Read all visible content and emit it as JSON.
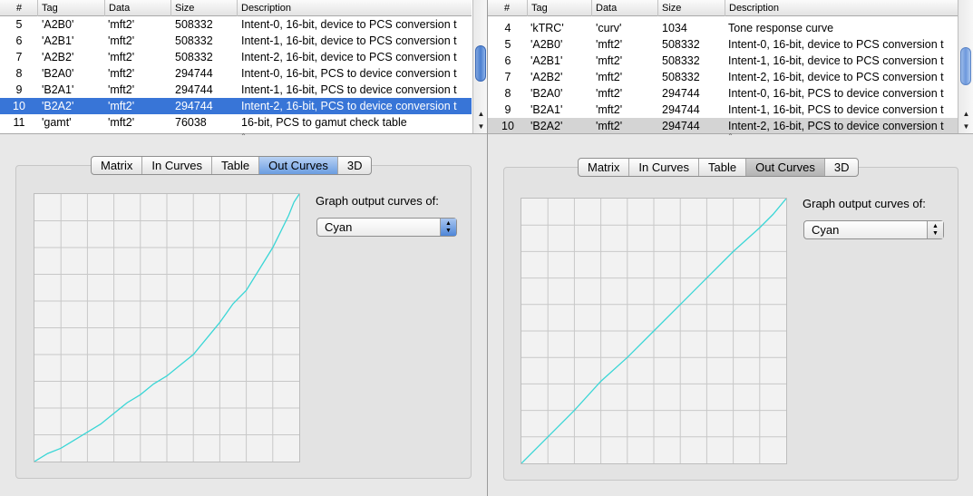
{
  "left": {
    "columns": [
      "#",
      "Tag",
      "Data",
      "Size",
      "Description"
    ],
    "rows": [
      {
        "n": "5",
        "tag": "'A2B0'",
        "data": "'mft2'",
        "size": "508332",
        "desc": "Intent-0, 16-bit, device to PCS conversion t"
      },
      {
        "n": "6",
        "tag": "'A2B1'",
        "data": "'mft2'",
        "size": "508332",
        "desc": "Intent-1, 16-bit, device to PCS conversion t"
      },
      {
        "n": "7",
        "tag": "'A2B2'",
        "data": "'mft2'",
        "size": "508332",
        "desc": "Intent-2, 16-bit, device to PCS conversion t"
      },
      {
        "n": "8",
        "tag": "'B2A0'",
        "data": "'mft2'",
        "size": "294744",
        "desc": "Intent-0, 16-bit, PCS to device conversion t"
      },
      {
        "n": "9",
        "tag": "'B2A1'",
        "data": "'mft2'",
        "size": "294744",
        "desc": "Intent-1, 16-bit, PCS to device conversion t"
      },
      {
        "n": "10",
        "tag": "'B2A2'",
        "data": "'mft2'",
        "size": "294744",
        "desc": "Intent-2, 16-bit, PCS to device conversion t"
      },
      {
        "n": "11",
        "tag": "'gamt'",
        "data": "'mft2'",
        "size": "76038",
        "desc": "16-bit, PCS to gamut check table"
      }
    ],
    "selected_row": 5,
    "tabs": [
      "Matrix",
      "In Curves",
      "Table",
      "Out Curves",
      "3D"
    ],
    "active_tab": 3,
    "graph_label": "Graph output curves of:",
    "channel": "Cyan",
    "curve_color": "#3ad6d6",
    "chart_data": {
      "type": "line",
      "x": [
        0,
        0.05,
        0.1,
        0.15,
        0.2,
        0.25,
        0.3,
        0.35,
        0.4,
        0.45,
        0.5,
        0.55,
        0.6,
        0.65,
        0.7,
        0.75,
        0.8,
        0.85,
        0.9,
        0.93,
        0.96,
        0.98,
        1.0
      ],
      "series": [
        {
          "values": [
            0,
            0.03,
            0.05,
            0.08,
            0.11,
            0.14,
            0.18,
            0.22,
            0.25,
            0.29,
            0.32,
            0.36,
            0.4,
            0.46,
            0.52,
            0.59,
            0.64,
            0.72,
            0.8,
            0.86,
            0.92,
            0.97,
            1.0
          ]
        }
      ],
      "xlim": [
        0,
        1
      ],
      "ylim": [
        0,
        1
      ],
      "grid": true
    }
  },
  "right": {
    "columns": [
      "#",
      "Tag",
      "Data",
      "Size",
      "Description"
    ],
    "rows": [
      {
        "n": "4",
        "tag": "'kTRC'",
        "data": "'curv'",
        "size": "1034",
        "desc": "Tone response curve"
      },
      {
        "n": "5",
        "tag": "'A2B0'",
        "data": "'mft2'",
        "size": "508332",
        "desc": "Intent-0, 16-bit, device to PCS conversion t"
      },
      {
        "n": "6",
        "tag": "'A2B1'",
        "data": "'mft2'",
        "size": "508332",
        "desc": "Intent-1, 16-bit, device to PCS conversion t"
      },
      {
        "n": "7",
        "tag": "'A2B2'",
        "data": "'mft2'",
        "size": "508332",
        "desc": "Intent-2, 16-bit, device to PCS conversion t"
      },
      {
        "n": "8",
        "tag": "'B2A0'",
        "data": "'mft2'",
        "size": "294744",
        "desc": "Intent-0, 16-bit, PCS to device conversion t"
      },
      {
        "n": "9",
        "tag": "'B2A1'",
        "data": "'mft2'",
        "size": "294744",
        "desc": "Intent-1, 16-bit, PCS to device conversion t"
      },
      {
        "n": "10",
        "tag": "'B2A2'",
        "data": "'mft2'",
        "size": "294744",
        "desc": "Intent-2, 16-bit, PCS to device conversion t"
      }
    ],
    "selected_row": 6,
    "tabs": [
      "Matrix",
      "In Curves",
      "Table",
      "Out Curves",
      "3D"
    ],
    "active_tab": 3,
    "graph_label": "Graph output curves of:",
    "channel": "Cyan",
    "curve_color": "#3ad6d6",
    "chart_data": {
      "type": "line",
      "x": [
        0,
        0.1,
        0.2,
        0.3,
        0.4,
        0.5,
        0.6,
        0.7,
        0.8,
        0.9,
        0.95,
        1.0
      ],
      "series": [
        {
          "values": [
            0,
            0.1,
            0.2,
            0.31,
            0.4,
            0.5,
            0.6,
            0.7,
            0.8,
            0.89,
            0.94,
            1.0
          ]
        }
      ],
      "xlim": [
        0,
        1
      ],
      "ylim": [
        0,
        1
      ],
      "grid": true
    }
  }
}
